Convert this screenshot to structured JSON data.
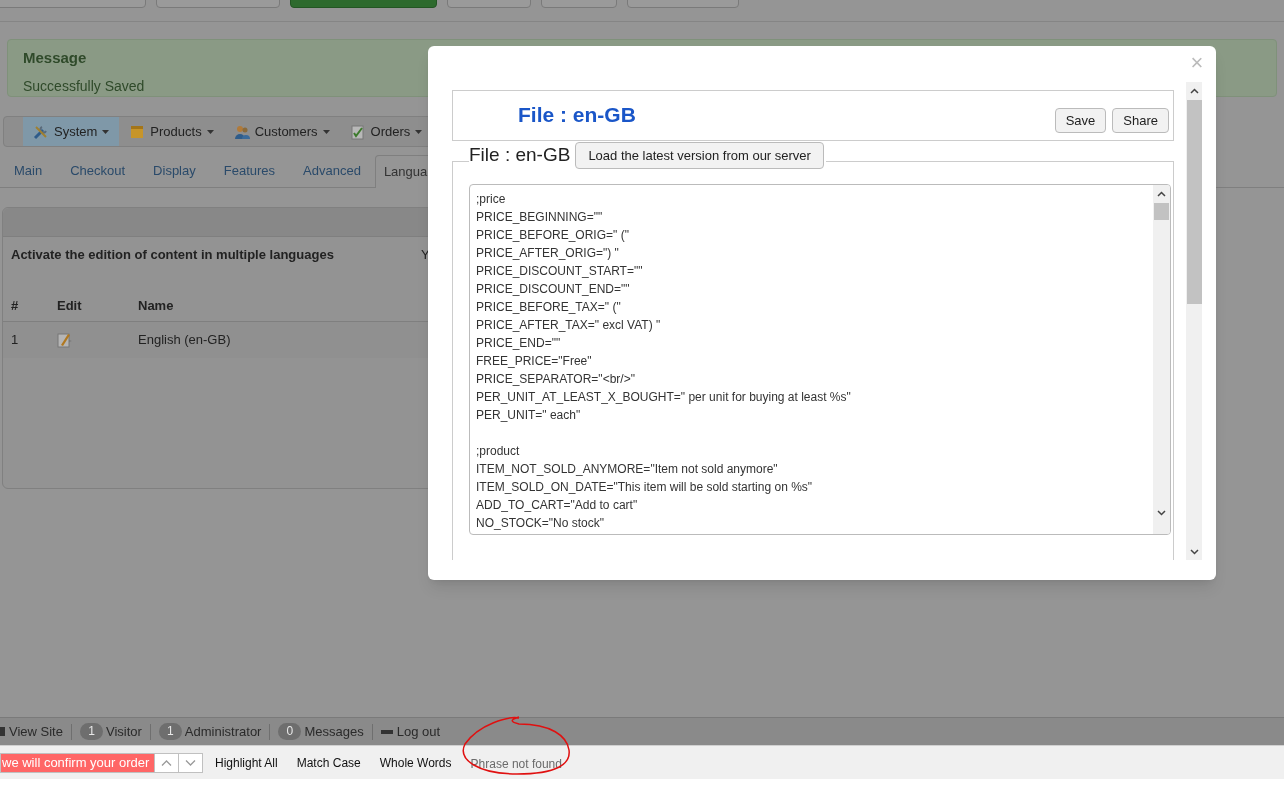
{
  "message": {
    "title": "Message",
    "text": "Successfully Saved"
  },
  "menu": [
    {
      "label": "System",
      "selected": true
    },
    {
      "label": "Products",
      "selected": false
    },
    {
      "label": "Customers",
      "selected": false
    },
    {
      "label": "Orders",
      "selected": false
    }
  ],
  "tabs": [
    {
      "label": "Main",
      "selected": false
    },
    {
      "label": "Checkout",
      "selected": false
    },
    {
      "label": "Display",
      "selected": false
    },
    {
      "label": "Features",
      "selected": false
    },
    {
      "label": "Advanced",
      "selected": false
    },
    {
      "label": "Langua",
      "selected": true
    }
  ],
  "panel": {
    "setting_label": "Activate the edition of content in multiple languages",
    "setting_value": "Y",
    "table": {
      "columns": [
        "#",
        "Edit",
        "Name"
      ],
      "rows": [
        {
          "number": "1",
          "name": "English (en-GB)"
        }
      ]
    }
  },
  "modal": {
    "close": "×",
    "title": "File : en-GB",
    "buttons": [
      "Save",
      "Share"
    ],
    "legend": "File : en-GB",
    "load_button": "Load the latest version from our server",
    "sections": [
      [
        ";price",
        "PRICE_BEGINNING=\"\"",
        "PRICE_BEFORE_ORIG=\" (\"",
        "PRICE_AFTER_ORIG=\") \"",
        "PRICE_DISCOUNT_START=\"\"",
        "PRICE_DISCOUNT_END=\"\"",
        "PRICE_BEFORE_TAX=\" (\"",
        "PRICE_AFTER_TAX=\" excl VAT) \"",
        "PRICE_END=\"\"",
        "FREE_PRICE=\"Free\"",
        "PRICE_SEPARATOR=\"<br/>\"",
        "PER_UNIT_AT_LEAST_X_BOUGHT=\" per unit for buying at least %s\"",
        "PER_UNIT=\" each\""
      ],
      [
        ";product",
        "ITEM_NOT_SOLD_ANYMORE=\"Item not sold anymore\"",
        "ITEM_SOLD_ON_DATE=\"This item will be sold starting on %s\"",
        "ADD_TO_CART=\"Add to cart\"",
        "NO_STOCK=\"No stock\""
      ]
    ]
  },
  "status_bar": [
    {
      "kind": "link",
      "label": "View Site"
    },
    {
      "kind": "count",
      "count": "1",
      "label": "Visitor"
    },
    {
      "kind": "count",
      "count": "1",
      "label": "Administrator"
    },
    {
      "kind": "count",
      "count": "0",
      "label": "Messages"
    },
    {
      "kind": "logout",
      "label": "Log out"
    }
  ],
  "find_bar": {
    "query": "we will confirm your order",
    "not_found": true,
    "options": [
      "Highlight All",
      "Match Case",
      "Whole Words"
    ],
    "status": "Phrase not found"
  }
}
